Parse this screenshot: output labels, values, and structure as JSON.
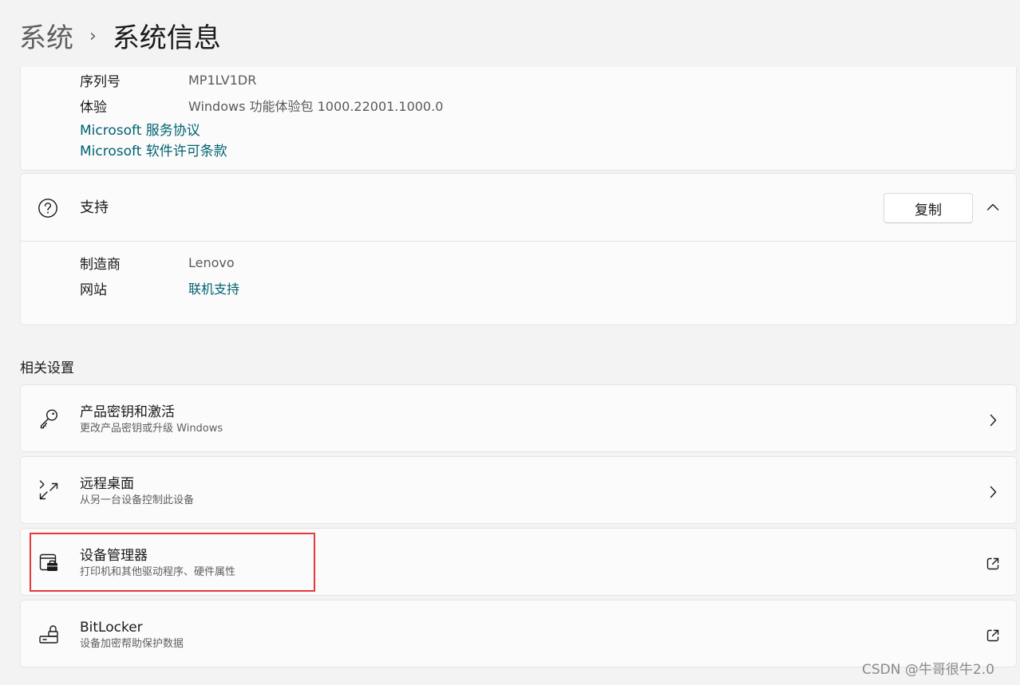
{
  "breadcrumb": {
    "parent": "系统",
    "separator": "›",
    "current": "系统信息"
  },
  "windows_spec": {
    "rows": [
      {
        "key": "序列号",
        "value": "MP1LV1DR"
      },
      {
        "key": "体验",
        "value": "Windows 功能体验包 1000.22001.1000.0"
      }
    ],
    "links": [
      "Microsoft 服务协议",
      "Microsoft 软件许可条款"
    ]
  },
  "support": {
    "icon": "help-icon",
    "title": "支持",
    "copy_label": "复制",
    "collapse_icon": "chevron-up-icon",
    "rows": [
      {
        "key": "制造商",
        "value": "Lenovo"
      },
      {
        "key": "网站",
        "value": "联机支持"
      }
    ]
  },
  "related": {
    "label": "相关设置",
    "items": [
      {
        "icon": "key-icon",
        "title": "产品密钥和激活",
        "subtitle": "更改产品密钥或升级 Windows",
        "action_icon": "chevron-right-icon"
      },
      {
        "icon": "remote-desktop-icon",
        "title": "远程桌面",
        "subtitle": "从另一台设备控制此设备",
        "action_icon": "chevron-right-icon"
      },
      {
        "icon": "device-manager-icon",
        "title": "设备管理器",
        "subtitle": "打印机和其他驱动程序、硬件属性",
        "action_icon": "external-link-icon"
      },
      {
        "icon": "bitlocker-icon",
        "title": "BitLocker",
        "subtitle": "设备加密帮助保护数据",
        "action_icon": "external-link-icon"
      }
    ]
  },
  "watermark": "CSDN @牛哥很牛2.0",
  "colors": {
    "link": "#006271",
    "highlight": "#e5393b",
    "background": "#f3f3f3",
    "card": "#fbfbfb"
  }
}
